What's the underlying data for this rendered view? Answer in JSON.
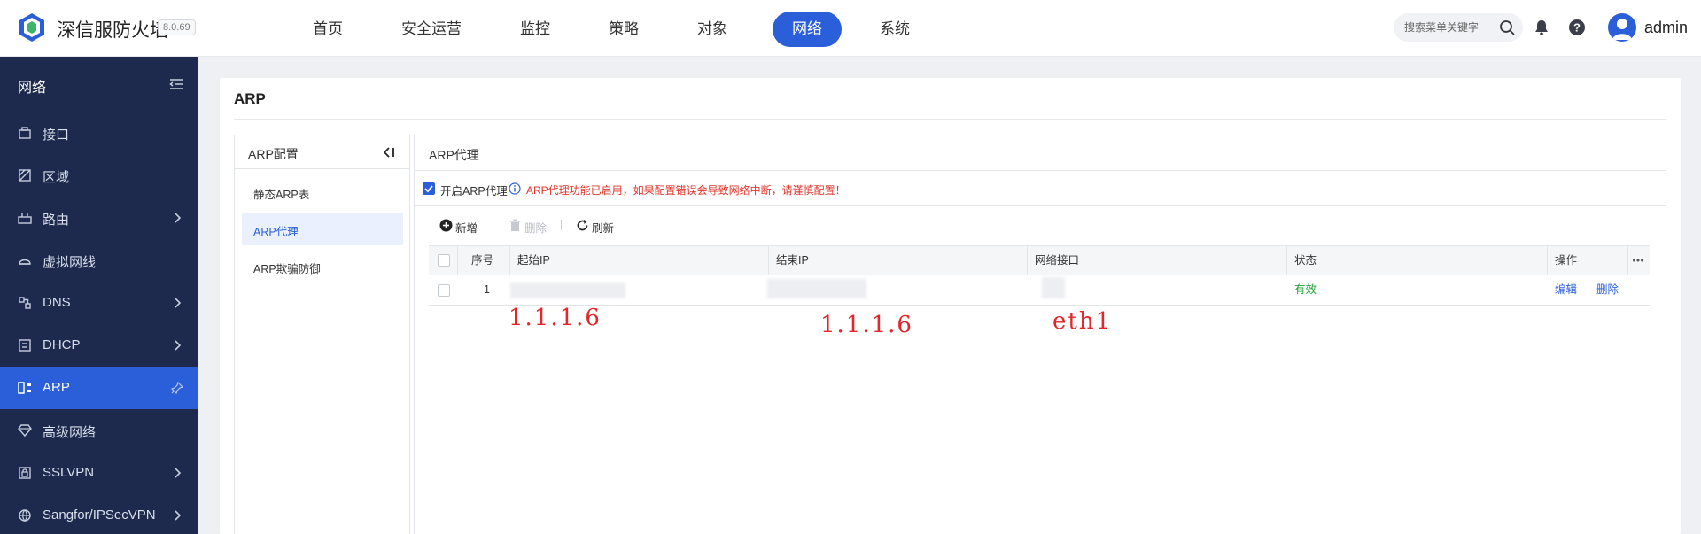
{
  "app": {
    "title": "深信服防火墙",
    "version": "8.0.69"
  },
  "nav": {
    "items": [
      {
        "label": "首页",
        "active": false
      },
      {
        "label": "安全运营",
        "active": false
      },
      {
        "label": "监控",
        "active": false
      },
      {
        "label": "策略",
        "active": false
      },
      {
        "label": "对象",
        "active": false
      },
      {
        "label": "网络",
        "active": true
      },
      {
        "label": "系统",
        "active": false
      }
    ]
  },
  "search": {
    "placeholder": "搜索菜单关键字"
  },
  "user": {
    "name": "admin"
  },
  "sidebar": {
    "title": "网络",
    "items": [
      {
        "label": "接口",
        "icon": "interface-icon",
        "has_children": false
      },
      {
        "label": "区域",
        "icon": "zone-icon",
        "has_children": false
      },
      {
        "label": "路由",
        "icon": "route-icon",
        "has_children": true
      },
      {
        "label": "虚拟网线",
        "icon": "virtual-wire-icon",
        "has_children": false
      },
      {
        "label": "DNS",
        "icon": "dns-icon",
        "has_children": true
      },
      {
        "label": "DHCP",
        "icon": "dhcp-icon",
        "has_children": true
      },
      {
        "label": "ARP",
        "icon": "arp-icon",
        "has_children": false,
        "active": true
      },
      {
        "label": "高级网络",
        "icon": "diamond-icon",
        "has_children": false
      },
      {
        "label": "SSLVPN",
        "icon": "sslvpn-icon",
        "has_children": true
      },
      {
        "label": "Sangfor/IPSecVPN",
        "icon": "ipsec-icon",
        "has_children": true
      }
    ]
  },
  "page": {
    "title": "ARP",
    "config_panel": {
      "title": "ARP配置",
      "items": [
        {
          "label": "静态ARP表",
          "active": false
        },
        {
          "label": "ARP代理",
          "active": true
        },
        {
          "label": "ARP欺骗防御",
          "active": false
        }
      ]
    },
    "proxy": {
      "title": "ARP代理",
      "enable_label": "开启ARP代理",
      "enabled": true,
      "warning": "ARP代理功能已启用，如果配置错误会导致网络中断，请谨慎配置！",
      "toolbar": {
        "add": "新增",
        "delete": "删除",
        "refresh": "刷新"
      },
      "table": {
        "columns": [
          "序号",
          "起始IP",
          "结束IP",
          "网络接口",
          "状态",
          "操作"
        ],
        "rows": [
          {
            "index": "1",
            "status": "有效",
            "edit": "编辑",
            "delete": "删除"
          }
        ]
      }
    },
    "annotations": {
      "start_ip": "1.1.1.6",
      "end_ip": "1.1.1.6",
      "interface": "eth1"
    }
  },
  "colors": {
    "accent": "#2b5fd9",
    "sidebar_bg": "#1d2a4d",
    "warning": "#e2342b",
    "valid": "#1fa336",
    "annotation": "#e2262a"
  }
}
